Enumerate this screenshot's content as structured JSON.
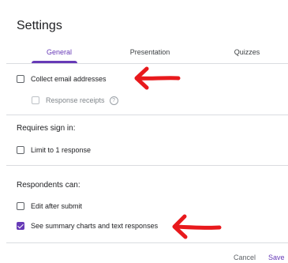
{
  "dialog": {
    "title": "Settings"
  },
  "tabs": [
    {
      "label": "General",
      "active": true
    },
    {
      "label": "Presentation",
      "active": false
    },
    {
      "label": "Quizzes",
      "active": false
    }
  ],
  "general": {
    "collect_email": {
      "label": "Collect email addresses",
      "checked": false
    },
    "response_receipts": {
      "label": "Response receipts",
      "checked": false,
      "disabled": true,
      "help_icon": "help-icon"
    }
  },
  "sign_in": {
    "title": "Requires sign in:",
    "limit_one": {
      "label": "Limit to 1 response",
      "checked": false
    }
  },
  "respondents": {
    "title": "Respondents can:",
    "edit_after_submit": {
      "label": "Edit after submit",
      "checked": false
    },
    "see_summary": {
      "label": "See summary charts and text responses",
      "checked": true
    }
  },
  "footer": {
    "cancel_label": "Cancel",
    "save_label": "Save"
  },
  "colors": {
    "accent": "#673ab7",
    "annotation_arrow": "#e8191c"
  }
}
